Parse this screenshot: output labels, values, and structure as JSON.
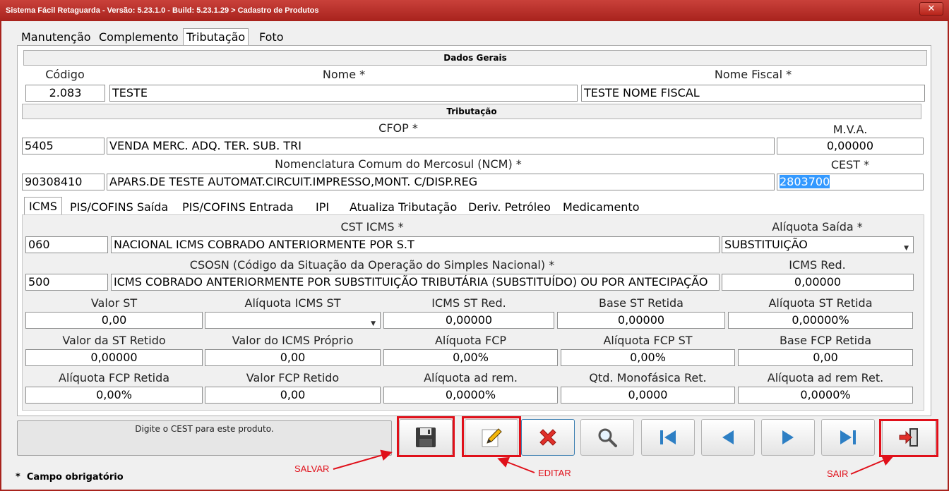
{
  "window": {
    "title": "Sistema Fácil Retaguarda - Versão: 5.23.1.0  - Build: 5.23.1.29 > Cadastro de Produtos",
    "close": "✕"
  },
  "tabs": [
    "Manutenção",
    "Complemento",
    "Tributação",
    "Foto"
  ],
  "dados_gerais": {
    "header": "Dados Gerais",
    "codigo_label": "Código",
    "codigo": "2.083",
    "nome_label": "Nome *",
    "nome": "TESTE",
    "nome_fiscal_label": "Nome Fiscal *",
    "nome_fiscal": "TESTE NOME FISCAL"
  },
  "tributacao": {
    "header": "Tributação",
    "cfop_label": "CFOP *",
    "cfop_code": "5405",
    "cfop_desc": "VENDA MERC. ADQ. TER. SUB. TRI",
    "mva_label": "M.V.A.",
    "mva": "0,00000",
    "ncm_label": "Nomenclatura Comum do Mercosul (NCM) *",
    "ncm_code": "90308410",
    "ncm_desc": "APARS.DE TESTE AUTOMAT.CIRCUIT.IMPRESSO,MONT. C/DISP.REG",
    "cest_label": "CEST *",
    "cest": "2803700"
  },
  "subtabs": [
    "ICMS",
    "PIS/COFINS Saída",
    "PIS/COFINS Entrada",
    "IPI",
    "Atualiza Tributação",
    "Deriv. Petróleo",
    "Medicamento"
  ],
  "icms": {
    "cst_label": "CST ICMS *",
    "cst_code": "060",
    "cst_desc": "NACIONAL ICMS COBRADO ANTERIORMENTE POR S.T",
    "aliq_saida_label": "Alíquota Saída *",
    "aliq_saida": "SUBSTITUIÇÃO",
    "csosn_label": "CSOSN (Código da Situação da Operação do Simples Nacional) *",
    "csosn_code": "500",
    "csosn_desc": "ICMS COBRADO ANTERIORMENTE POR SUBSTITUIÇÃO TRIBUTÁRIA (SUBSTITUÍDO) OU POR ANTECIPAÇÃO",
    "icms_red_label": "ICMS Red.",
    "icms_red": "0,00000",
    "row1": [
      {
        "label": "Valor ST",
        "value": "0,00"
      },
      {
        "label": "Alíquota ICMS ST",
        "value": ""
      },
      {
        "label": "ICMS ST Red.",
        "value": "0,00000"
      },
      {
        "label": "Base ST Retida",
        "value": "0,00000"
      },
      {
        "label": "Alíquota ST Retida",
        "value": "0,00000%"
      }
    ],
    "row2": [
      {
        "label": "Valor da ST Retido",
        "value": "0,00000"
      },
      {
        "label": "Valor do ICMS Próprio",
        "value": "0,00"
      },
      {
        "label": "Alíquota FCP",
        "value": "0,00%"
      },
      {
        "label": "Alíquota FCP ST",
        "value": "0,00%"
      },
      {
        "label": "Base FCP Retida",
        "value": "0,00"
      }
    ],
    "row3": [
      {
        "label": "Alíquota FCP Retida",
        "value": "0,00%"
      },
      {
        "label": "Valor FCP Retido",
        "value": "0,00"
      },
      {
        "label": "Alíquota ad rem.",
        "value": "0,0000%"
      },
      {
        "label": "Qtd. Monofásica Ret.",
        "value": "0,0000"
      },
      {
        "label": "Alíquota ad rem Ret.",
        "value": "0,0000%"
      }
    ]
  },
  "status": {
    "hint": "Digite o CEST para este produto.",
    "required": "Campo obrigatório",
    "star": "*"
  },
  "annotations": {
    "salvar": "SALVAR",
    "editar": "EDITAR",
    "sair": "SAIR",
    "color": "#e0101a"
  }
}
